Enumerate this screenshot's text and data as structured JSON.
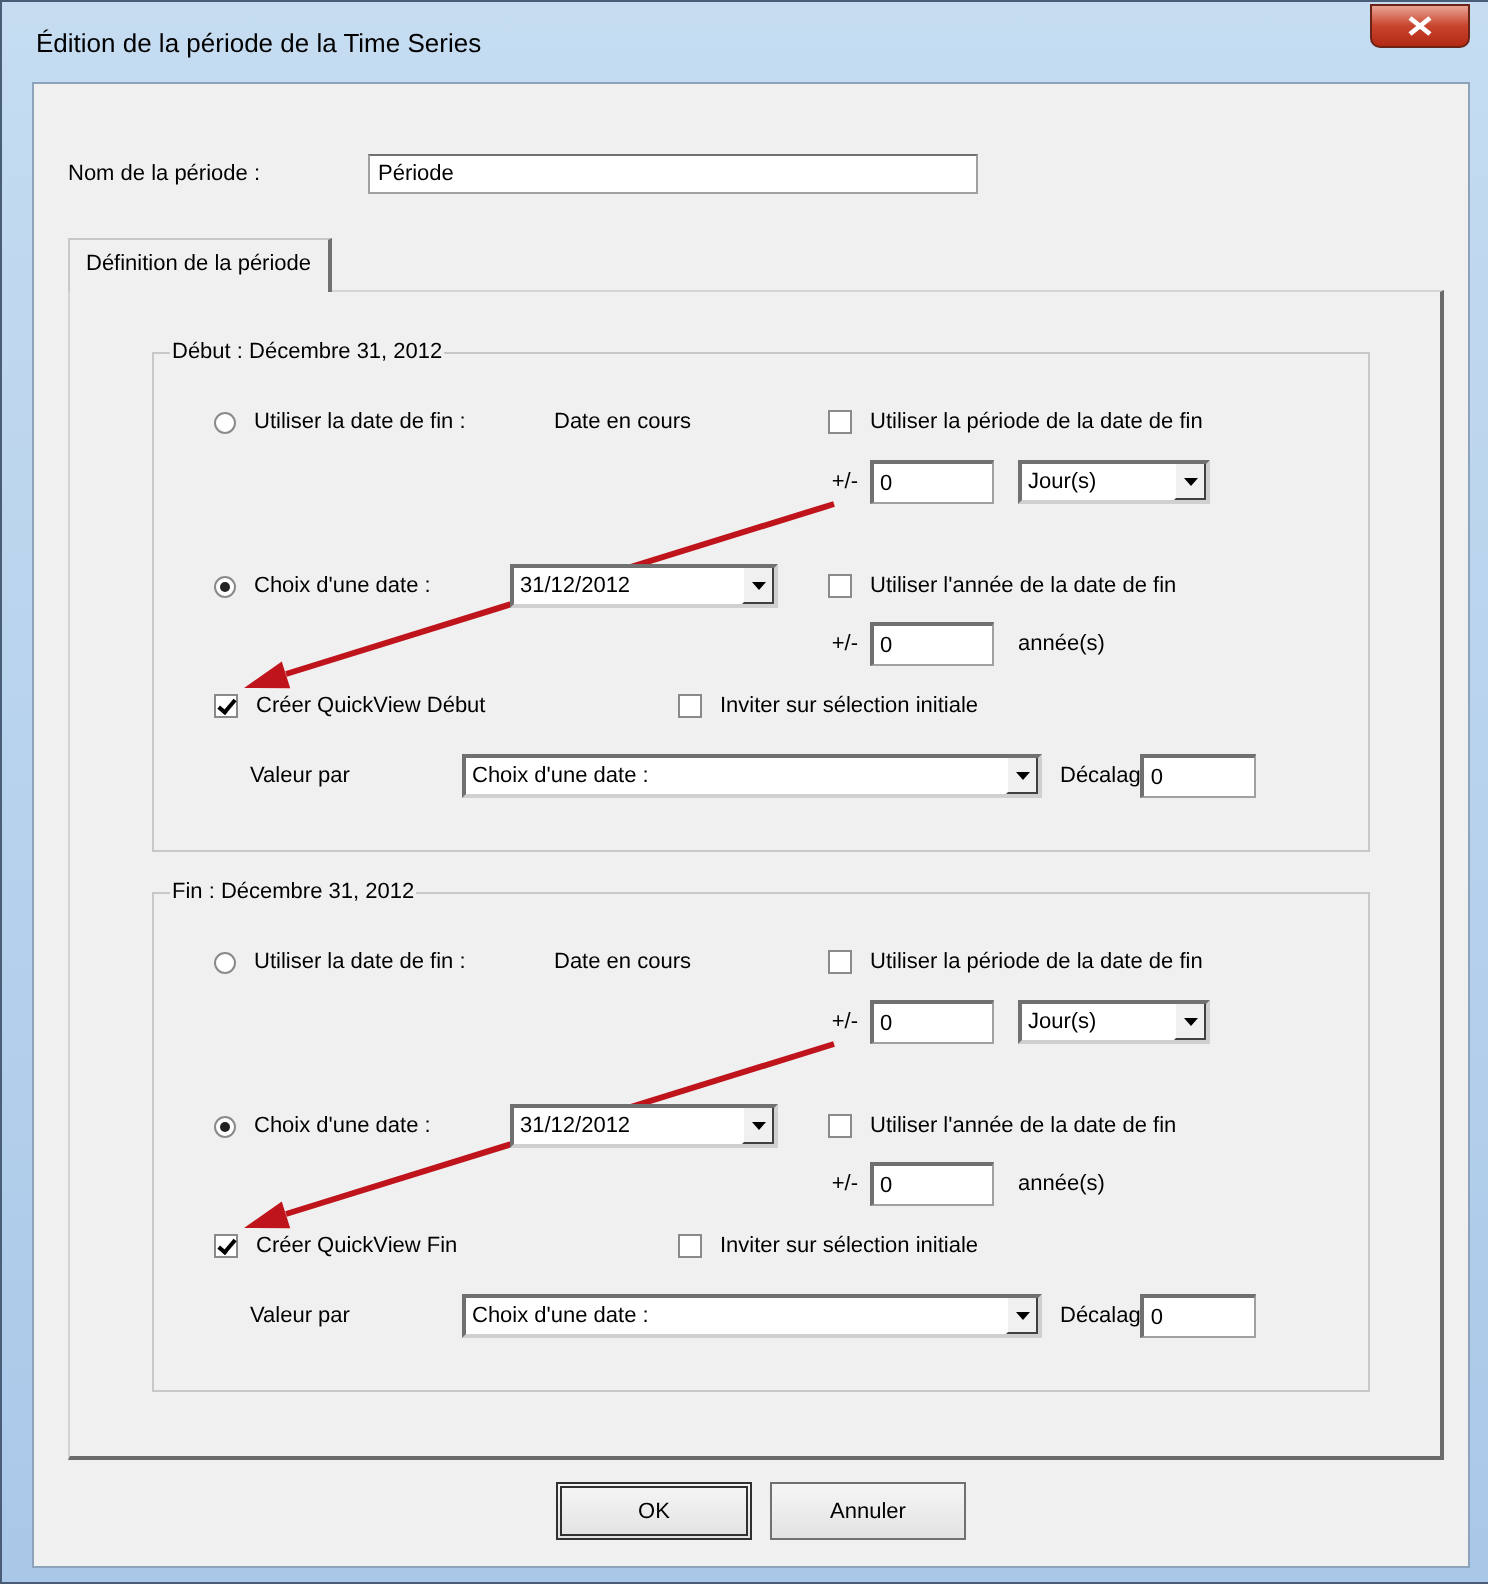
{
  "window": {
    "title": "Édition de la période de la Time Series"
  },
  "name_field": {
    "label": "Nom de la période :",
    "value": "Période"
  },
  "tabs": [
    {
      "label": "Définition de la période",
      "selected": true
    }
  ],
  "groups": [
    {
      "title": "Début : Décembre 31, 2012",
      "use_end_date": {
        "label": "Utiliser la date de fin :",
        "value": "Date en cours",
        "selected": false
      },
      "use_period": {
        "label": "Utiliser la période de la date de fin",
        "checked": false
      },
      "period_offset": {
        "sign": "+/-",
        "value": "0",
        "unit": "Jour(s)"
      },
      "choose_date": {
        "label": "Choix d'une date :",
        "date": "31/12/2012",
        "selected": true
      },
      "use_year": {
        "label": "Utiliser l'année de la date de fin",
        "checked": false
      },
      "year_offset": {
        "sign": "+/-",
        "value": "0",
        "unit": "année(s)"
      },
      "quickview": {
        "label": "Créer QuickView Début",
        "checked": true
      },
      "prompt": {
        "label": "Inviter sur sélection initiale",
        "checked": false
      },
      "value_by": {
        "label": "Valeur par",
        "value": "Choix d'une date :"
      },
      "offset": {
        "label": "Décalag",
        "value": "0"
      },
      "arrow": true
    },
    {
      "title": "Fin : Décembre 31, 2012",
      "use_end_date": {
        "label": "Utiliser la date de fin :",
        "value": "Date en cours",
        "selected": false
      },
      "use_period": {
        "label": "Utiliser la période de la date de fin",
        "checked": false
      },
      "period_offset": {
        "sign": "+/-",
        "value": "0",
        "unit": "Jour(s)"
      },
      "choose_date": {
        "label": "Choix d'une date :",
        "date": "31/12/2012",
        "selected": true
      },
      "use_year": {
        "label": "Utiliser l'année de la date de fin",
        "checked": false
      },
      "year_offset": {
        "sign": "+/-",
        "value": "0",
        "unit": "année(s)"
      },
      "quickview": {
        "label": "Créer QuickView Fin",
        "checked": true
      },
      "prompt": {
        "label": "Inviter sur sélection initiale",
        "checked": false
      },
      "value_by": {
        "label": "Valeur par",
        "value": "Choix d'une date :"
      },
      "offset": {
        "label": "Décalag",
        "value": "0"
      },
      "arrow": true
    }
  ],
  "buttons": [
    {
      "label": "OK",
      "default": true
    },
    {
      "label": "Annuler",
      "default": false
    }
  ]
}
